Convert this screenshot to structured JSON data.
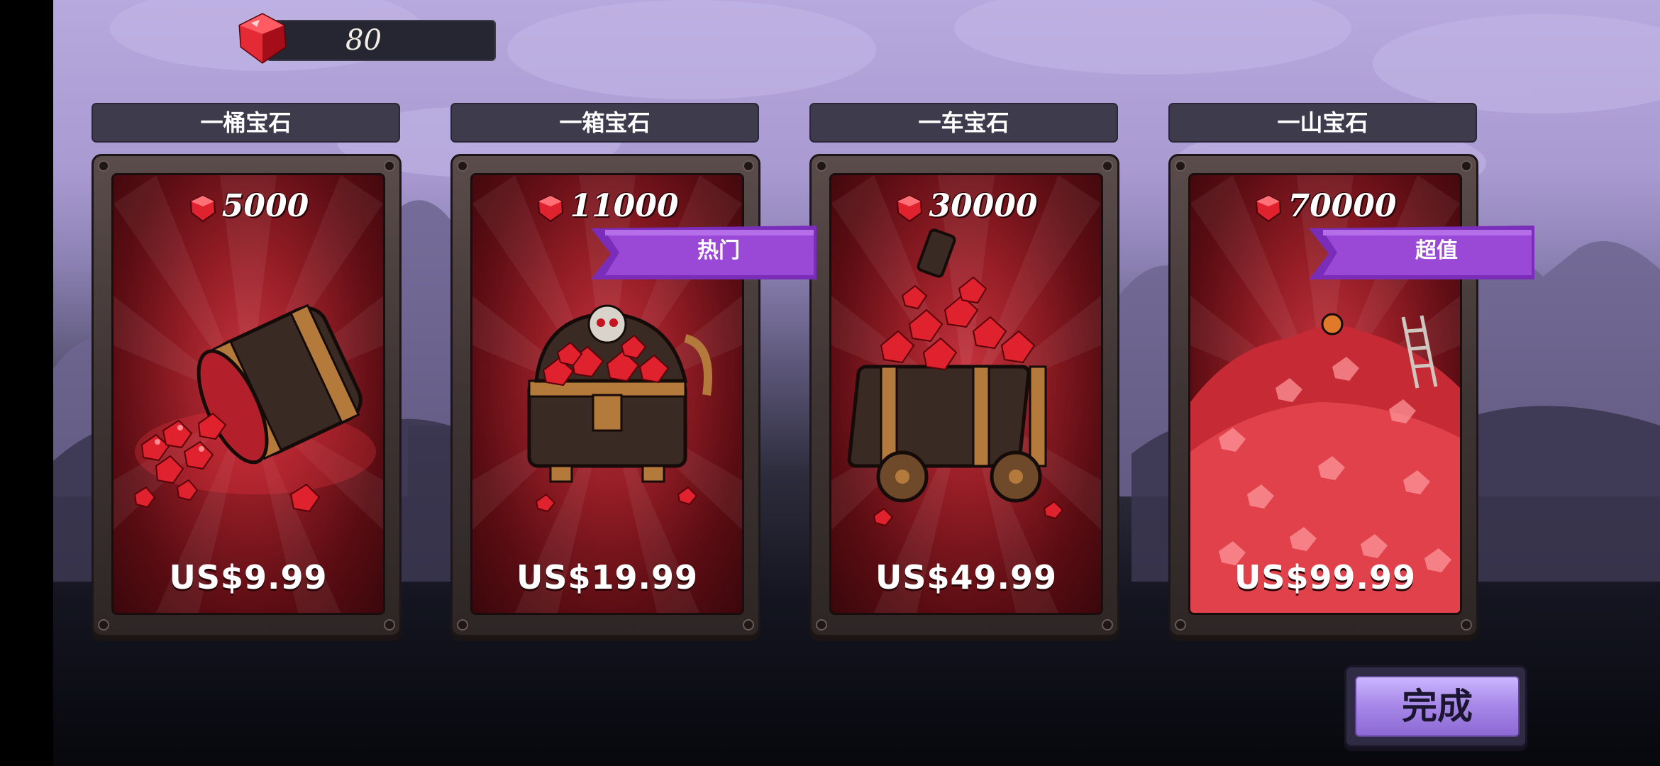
{
  "gem_balance": "80",
  "packs": [
    {
      "title": "一桶宝石",
      "amount": "5000",
      "price": "US$9.99",
      "badge": "",
      "illustration": "gem-barrel"
    },
    {
      "title": "一箱宝石",
      "amount": "11000",
      "price": "US$19.99",
      "badge": "热门",
      "illustration": "gem-chest"
    },
    {
      "title": "一车宝石",
      "amount": "30000",
      "price": "US$49.99",
      "badge": "",
      "illustration": "gem-cart"
    },
    {
      "title": "一山宝石",
      "amount": "70000",
      "price": "US$99.99",
      "badge": "超值",
      "illustration": "gem-mountain"
    }
  ],
  "done_button": {
    "label": "完成"
  },
  "colors": {
    "gem_red": "#e0222f",
    "badge_purple": "#8e3fc7",
    "button_purple": "#a98ae9",
    "panel_red": "#951d26"
  }
}
